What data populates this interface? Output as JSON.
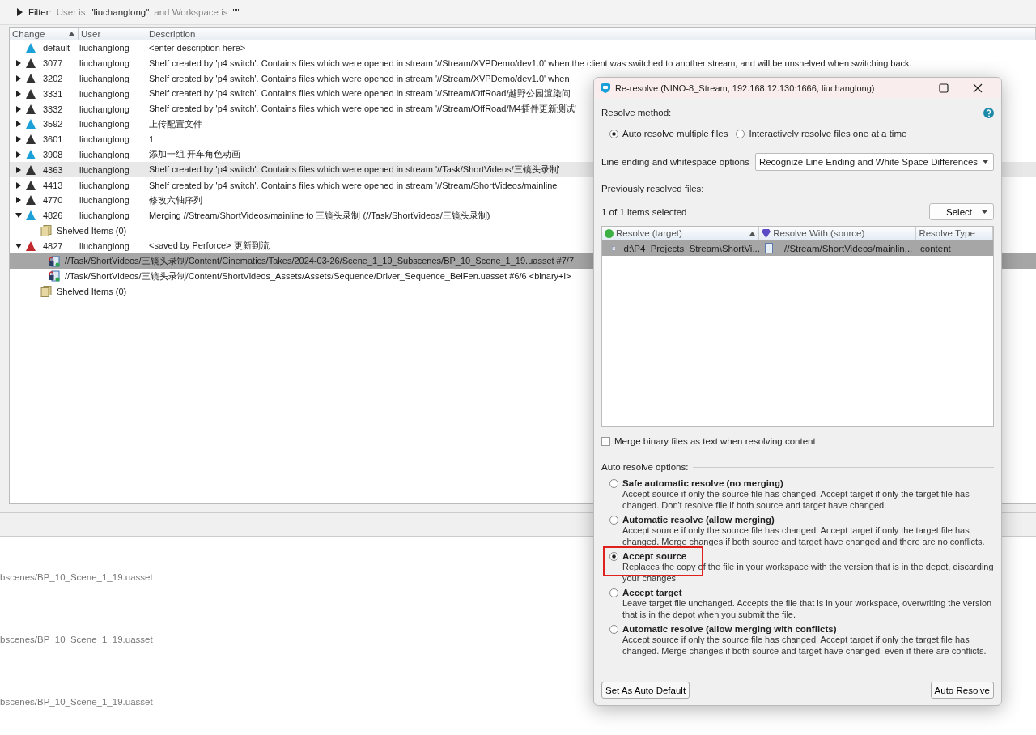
{
  "filter": {
    "label": "Filter:",
    "parts": [
      {
        "text": "User is",
        "emphasis": false
      },
      {
        "text": "\"liuchanglong\"",
        "emphasis": true
      },
      {
        "text": "and Workspace is",
        "emphasis": false
      },
      {
        "text": "\"\"",
        "emphasis": true
      }
    ]
  },
  "table": {
    "columns": [
      {
        "label": "Change",
        "sorted": true
      },
      {
        "label": "User",
        "sorted": false
      },
      {
        "label": "Description",
        "sorted": false
      }
    ],
    "rows": [
      {
        "kind": "changelist",
        "change": "default",
        "user": "liuchanglong",
        "description": "<enter description here>",
        "color": "#1ba1d8",
        "selected": false,
        "hovered": false
      },
      {
        "kind": "changelist",
        "change": "3077",
        "user": "liuchanglong",
        "description": "Shelf created by 'p4 switch'. Contains files which were opened in stream '//Stream/XVPDemo/dev1.0' when the client was switched to another stream, and will be unshelved when switching back.",
        "color": "#333333",
        "expanded": false,
        "selected": false,
        "hovered": false
      },
      {
        "kind": "changelist",
        "change": "3202",
        "user": "liuchanglong",
        "description": "Shelf created by 'p4 switch'. Contains files which were opened in stream '//Stream/XVPDemo/dev1.0' when",
        "color": "#333333",
        "expanded": false,
        "selected": false,
        "hovered": false
      },
      {
        "kind": "changelist",
        "change": "3331",
        "user": "liuchanglong",
        "description": "Shelf created by 'p4 switch'. Contains files which were opened in stream '//Stream/OffRoad/越野公园渲染问",
        "color": "#333333",
        "expanded": false,
        "selected": false,
        "hovered": false
      },
      {
        "kind": "changelist",
        "change": "3332",
        "user": "liuchanglong",
        "description": "Shelf created by 'p4 switch'. Contains files which were opened in stream '//Stream/OffRoad/M4插件更新测试'",
        "color": "#333333",
        "expanded": false,
        "selected": false,
        "hovered": false
      },
      {
        "kind": "changelist",
        "change": "3592",
        "user": "liuchanglong",
        "description": "上传配置文件",
        "color": "#1ba1d8",
        "expanded": false,
        "selected": false,
        "hovered": false
      },
      {
        "kind": "changelist",
        "change": "3601",
        "user": "liuchanglong",
        "description": "1",
        "color": "#333333",
        "expanded": false,
        "selected": false,
        "hovered": false
      },
      {
        "kind": "changelist",
        "change": "3908",
        "user": "liuchanglong",
        "description": "添加一组 开车角色动画",
        "color": "#1ba1d8",
        "expanded": false,
        "selected": false,
        "hovered": false
      },
      {
        "kind": "changelist",
        "change": "4363",
        "user": "liuchanglong",
        "description": "Shelf created by 'p4 switch'. Contains files which were opened in stream '//Task/ShortVideos/三镜头录制'",
        "color": "#333333",
        "expanded": false,
        "selected": false,
        "hovered": true
      },
      {
        "kind": "changelist",
        "change": "4413",
        "user": "liuchanglong",
        "description": "Shelf created by 'p4 switch'. Contains files which were opened in stream '//Stream/ShortVideos/mainline'",
        "color": "#333333",
        "expanded": false,
        "selected": false,
        "hovered": false
      },
      {
        "kind": "changelist",
        "change": "4770",
        "user": "liuchanglong",
        "description": "修改六轴序列",
        "color": "#333333",
        "expanded": false,
        "selected": false,
        "hovered": false
      },
      {
        "kind": "changelist",
        "change": "4826",
        "user": "liuchanglong",
        "description": "Merging //Stream/ShortVideos/mainline to 三镜头录制 (//Task/ShortVideos/三镜头录制)",
        "color": "#1ba1d8",
        "expanded": true,
        "selected": false,
        "hovered": false,
        "children": [
          {
            "kind": "shelved",
            "label": "Shelved Items (0)",
            "selected": false,
            "hovered": false
          }
        ]
      },
      {
        "kind": "changelist",
        "change": "4827",
        "user": "liuchanglong",
        "description": "<saved by Perforce> 更新到流",
        "color": "#c0282d",
        "expanded": true,
        "selected": false,
        "hovered": false,
        "children": [
          {
            "kind": "file",
            "path": "//Task/ShortVideos/三镜头录制/Content/Cinematics/Takes/2024-03-26/Scene_1_19_Subscenes/BP_10_Scene_1_19.uasset #7/7",
            "selected": true,
            "hovered": false
          },
          {
            "kind": "file",
            "path": "//Task/ShortVideos/三镜头录制/Content/ShortVideos_Assets/Assets/Sequence/Driver_Sequence_BeiFen.uasset #6/6 <binary+l>",
            "selected": false,
            "hovered": false
          },
          {
            "kind": "shelved",
            "label": "Shelved Items (0)",
            "selected": false,
            "hovered": false
          }
        ]
      }
    ]
  },
  "detail_lines": [
    "bscenes/BP_10_Scene_1_19.uasset",
    "bscenes/BP_10_Scene_1_19.uasset",
    "bscenes/BP_10_Scene_1_19.uasset"
  ],
  "dialog": {
    "title": "Re-resolve (NINO-8_Stream,  192.168.12.130:1666,  liuchanglong)",
    "resolve_method": {
      "label": "Resolve method:",
      "options": [
        {
          "label": "Auto resolve multiple files",
          "selected": true
        },
        {
          "label": "Interactively resolve files one at a time",
          "selected": false
        }
      ]
    },
    "line_ending": {
      "label": "Line ending and whitespace options",
      "value": "Recognize Line Ending and White Space Differences"
    },
    "previous": {
      "label": "Previously resolved files:",
      "count": "1 of 1 items selected",
      "select_button": "Select"
    },
    "files": {
      "columns": [
        {
          "label": "Resolve (target)",
          "sorted": true,
          "color": "#3cb043"
        },
        {
          "label": "Resolve With (source)",
          "sorted": false,
          "color": "#5b4bc4"
        },
        {
          "label": "Resolve Type",
          "sorted": false
        }
      ],
      "rows": [
        {
          "target": "d:\\P4_Projects_Stream\\ShortVi...",
          "source": "//Stream/ShortVideos/mainlin...",
          "type": "content",
          "selected": true
        }
      ]
    },
    "merge_binary": {
      "label": "Merge binary files as text when resolving content",
      "checked": false
    },
    "auto_options": {
      "label": "Auto resolve options:",
      "options": [
        {
          "title": "Safe automatic resolve (no merging)",
          "description": "Accept source if only the source file has changed. Accept target if only the target file has changed. Don't resolve file if both source and target have changed.",
          "selected": false,
          "annotated": false
        },
        {
          "title": "Automatic resolve (allow merging)",
          "description": "Accept source if only the source file has changed. Accept target if only the target file has changed. Merge changes if both source and target have changed and there are no conflicts.",
          "selected": false,
          "annotated": false
        },
        {
          "title": "Accept source",
          "description": "Replaces the copy of the file in your workspace with the version that is in the depot, discarding your changes.",
          "selected": true,
          "annotated": true
        },
        {
          "title": "Accept target",
          "description": "Leave target file unchanged. Accepts the file that is in your workspace, overwriting the version that is in the depot when you submit the file.",
          "selected": false,
          "annotated": false
        },
        {
          "title": "Automatic resolve (allow merging with conflicts)",
          "description": "Accept source if only the source file has changed. Accept target if only the target file has changed. Merge changes if both source and target have changed, even if there are conflicts.",
          "selected": false,
          "annotated": false
        }
      ]
    },
    "buttons": [
      "Set As Auto Default",
      "Auto Resolve"
    ]
  }
}
